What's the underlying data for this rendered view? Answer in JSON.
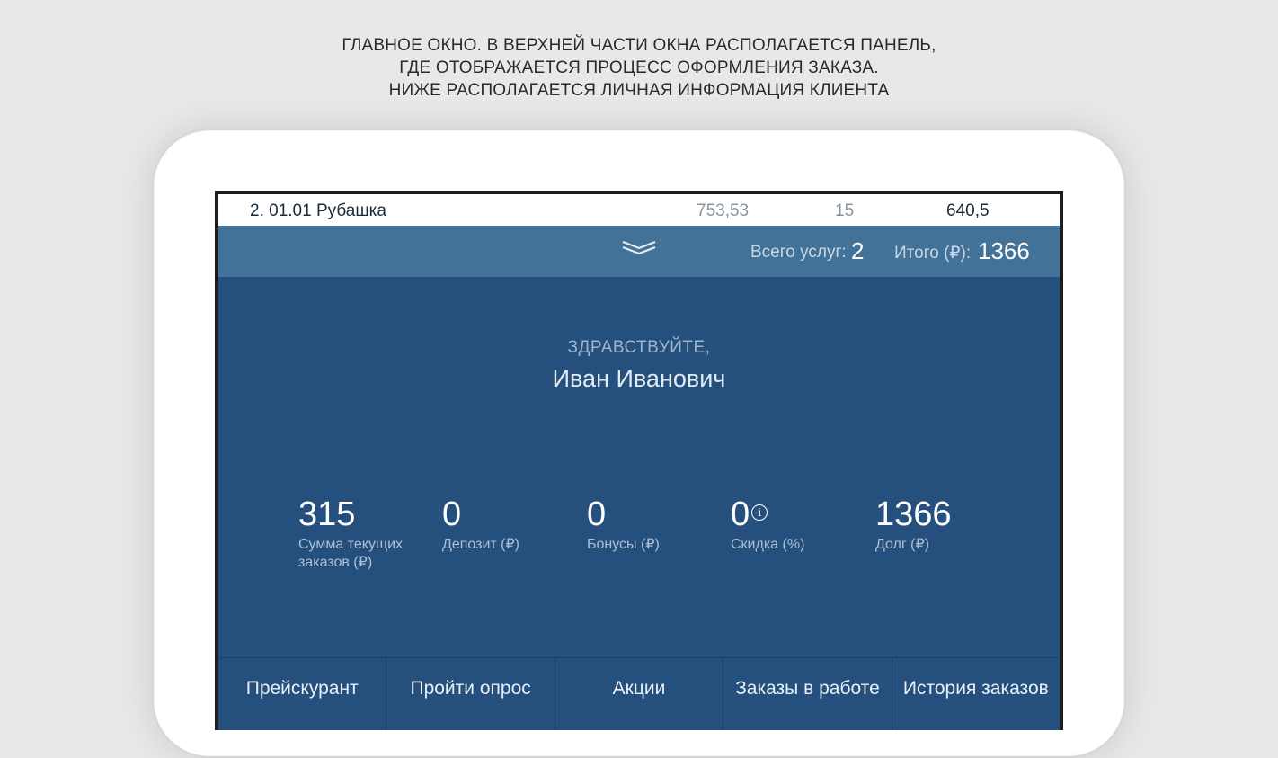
{
  "caption": {
    "line1": "ГЛАВНОЕ ОКНО. В ВЕРХНЕЙ ЧАСТИ ОКНА РАСПОЛАГАЕТСЯ ПАНЕЛЬ,",
    "line2": "ГДЕ ОТОБРАЖАЕТСЯ ПРОЦЕСС ОФОРМЛЕНИЯ ЗАКАЗА.",
    "line3": "НИЖЕ РАСПОЛАГАЕТСЯ ЛИЧНАЯ ИНФОРМАЦИЯ КЛИЕНТА"
  },
  "order_row": {
    "name": "2. 01.01 Рубашка",
    "price": "753,53",
    "qty": "15",
    "sum": "640,5"
  },
  "summary": {
    "services_label": "Всего услуг:",
    "services_value": "2",
    "total_label": "Итого (₽):",
    "total_value": "1366",
    "expand_icon": "chevron-down-icon"
  },
  "greeting": {
    "hello": "ЗДРАВСТВУЙТЕ,",
    "name": "Иван Иванович"
  },
  "stats": [
    {
      "value": "315",
      "label": "Сумма текущих заказов (₽)"
    },
    {
      "value": "0",
      "label": "Депозит (₽)"
    },
    {
      "value": "0",
      "label": "Бонусы (₽)"
    },
    {
      "value": "0",
      "label": "Скидка (%)",
      "info_icon": "i"
    },
    {
      "value": "1366",
      "label": "Долг (₽)"
    }
  ],
  "nav": [
    {
      "label": "Прейскурант"
    },
    {
      "label": "Пройти опрос"
    },
    {
      "label": "Акции"
    },
    {
      "label": "Заказы в работе"
    },
    {
      "label": "История заказов"
    }
  ],
  "colors": {
    "background": "#e8e8e8",
    "panel": "#25507d",
    "summary_bar": "#427298",
    "nav_divider": "#1d3f63"
  }
}
